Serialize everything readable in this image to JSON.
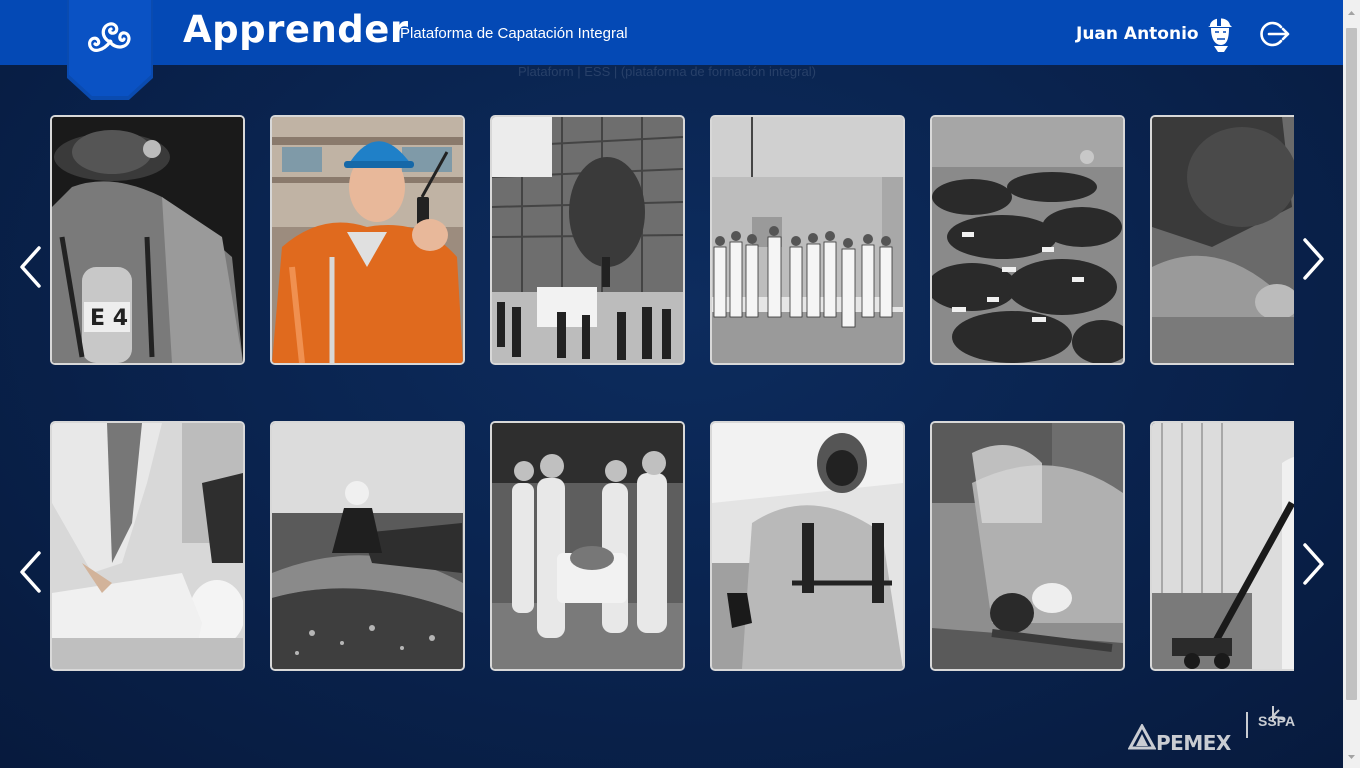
{
  "header": {
    "title": "Apprender",
    "subtitle": "Plataforma de Capatación Integral",
    "user_name": "Juan Antonio",
    "ghost_breadcrumb": "Plataform | ESS | (plataforma de formación integral)"
  },
  "icons": {
    "logo": "triskelion-logo-icon",
    "avatar": "worker-helmet-avatar-icon",
    "logout": "logout-icon",
    "prev": "chevron-left-icon",
    "next": "chevron-right-icon"
  },
  "colors": {
    "header_bg": "#0449b5",
    "page_bg": "#0a2450",
    "card_border": "#d8d8d8"
  },
  "carousels": [
    {
      "cards": [
        {
          "subject": "firefighter with breathing apparatus",
          "tone": "grayscale"
        },
        {
          "subject": "worker in orange coverall with hard hat and radio",
          "tone": "color"
        },
        {
          "subject": "office building with people outside",
          "tone": "grayscale"
        },
        {
          "subject": "group of workers in front of wall",
          "tone": "grayscale"
        },
        {
          "subject": "survival suits in water",
          "tone": "grayscale"
        },
        {
          "subject": "welder close-up",
          "tone": "grayscale"
        }
      ]
    },
    {
      "cards": [
        {
          "subject": "CPR training mannequin",
          "tone": "grayscale"
        },
        {
          "subject": "rescue boat on sea",
          "tone": "grayscale"
        },
        {
          "subject": "rescue team carrying stretcher",
          "tone": "grayscale"
        },
        {
          "subject": "worker in hazmat suit with respirator",
          "tone": "grayscale"
        },
        {
          "subject": "worker grinding with face shield",
          "tone": "grayscale"
        },
        {
          "subject": "worker with pallet jack",
          "tone": "grayscale"
        }
      ]
    }
  ],
  "footer": {
    "pemex": "PEMEX",
    "sspa": "SSPA"
  }
}
